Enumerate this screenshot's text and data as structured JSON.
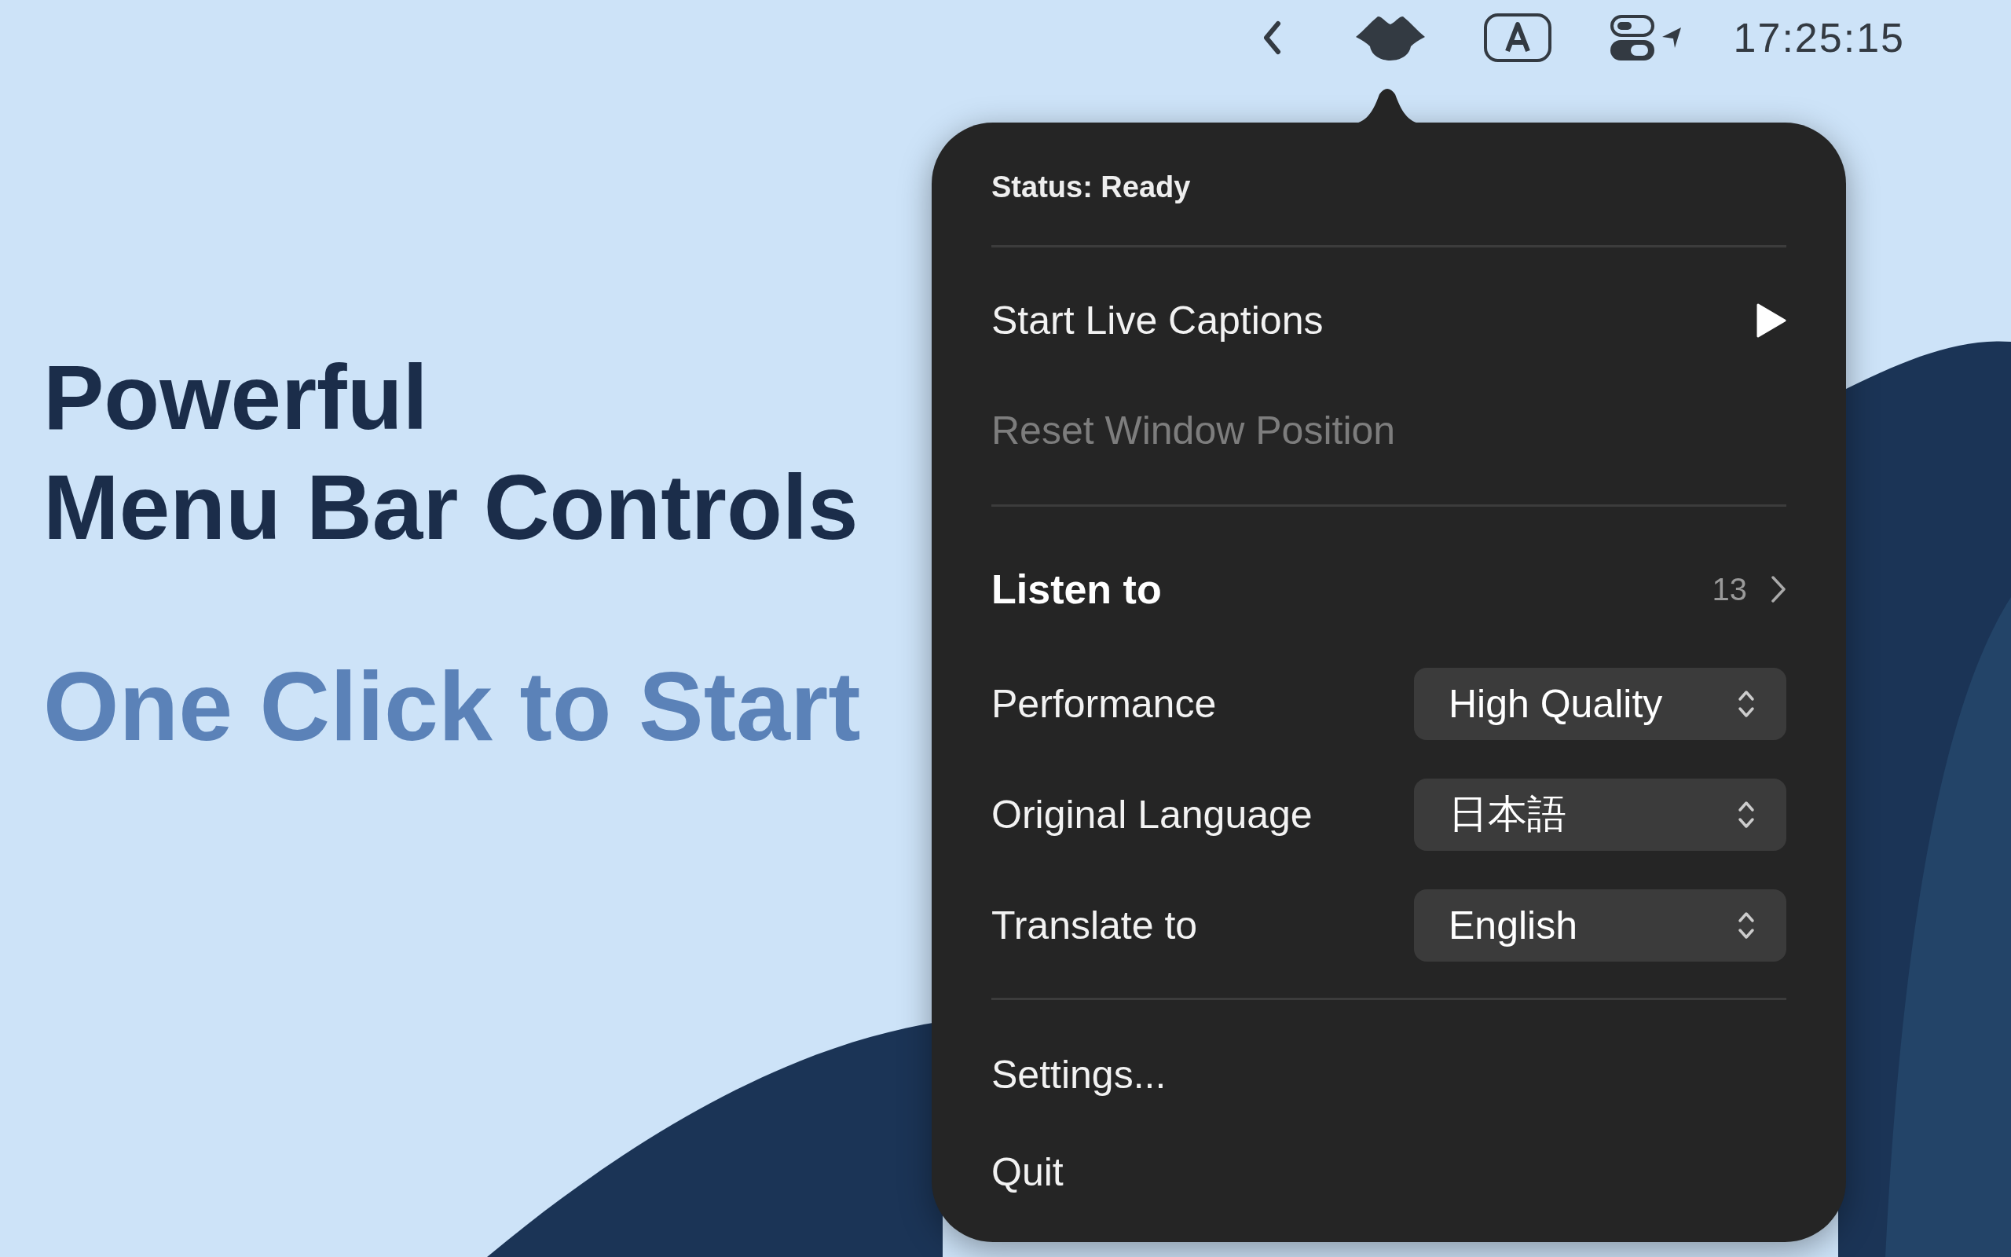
{
  "menu_bar": {
    "clock": "17:25:15"
  },
  "headline": {
    "lines": [
      "Powerful",
      "Menu Bar Controls"
    ],
    "tagline": "One Click to Start"
  },
  "menu": {
    "status": "Status: Ready",
    "actions": [
      {
        "label": "Start Live Captions",
        "kind": "play",
        "disabled": false
      },
      {
        "label": "Reset Window Position",
        "kind": "plain",
        "disabled": true
      }
    ],
    "listen": {
      "label": "Listen to",
      "count": "13"
    },
    "settings": [
      {
        "label": "Performance",
        "value": "High Quality"
      },
      {
        "label": "Original Language",
        "value": "日本語"
      },
      {
        "label": "Translate to",
        "value": "English"
      }
    ],
    "footer": [
      "Settings...",
      "Quit"
    ]
  }
}
